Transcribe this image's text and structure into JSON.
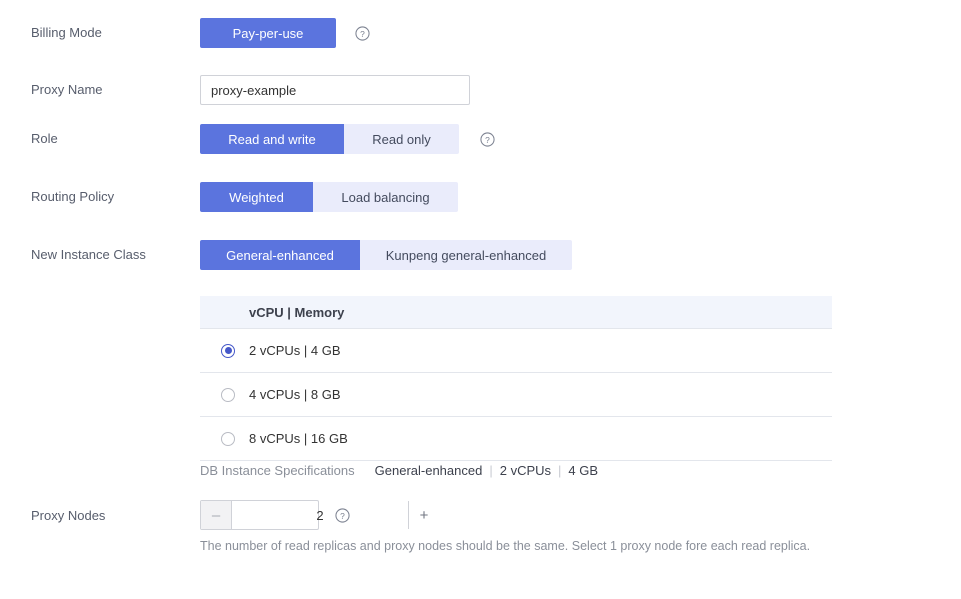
{
  "colors": {
    "accent": "#5b74de",
    "accent_inactive": "#eaecfb",
    "radio_checked": "#4558c9",
    "label": "#575d6c",
    "muted": "#8a8f99",
    "table_header_bg": "#f2f5fc",
    "border": "#e3e6ec"
  },
  "billing_mode": {
    "label": "Billing Mode",
    "options": [
      {
        "label": "Pay-per-use",
        "selected": true
      }
    ],
    "help_icon": "help-circle-icon"
  },
  "proxy_name": {
    "label": "Proxy Name",
    "value": "proxy-example",
    "placeholder": "proxy-example"
  },
  "role": {
    "label": "Role",
    "options": [
      {
        "label": "Read and write",
        "selected": true
      },
      {
        "label": "Read only",
        "selected": false
      }
    ],
    "help_icon": "help-circle-icon"
  },
  "routing_policy": {
    "label": "Routing Policy",
    "options": [
      {
        "label": "Weighted",
        "selected": true
      },
      {
        "label": "Load balancing",
        "selected": false
      }
    ]
  },
  "instance_class": {
    "label": "New Instance Class",
    "options": [
      {
        "label": "General-enhanced",
        "selected": true
      },
      {
        "label": "Kunpeng general-enhanced",
        "selected": false
      }
    ]
  },
  "spec_table": {
    "columns": [
      "vCPU | Memory"
    ],
    "rows": [
      {
        "label": "2 vCPUs | 4 GB",
        "selected": true
      },
      {
        "label": "4 vCPUs | 8 GB",
        "selected": false
      },
      {
        "label": "8 vCPUs | 16 GB",
        "selected": false
      }
    ]
  },
  "spec_summary": {
    "label": "DB Instance Specifications",
    "class": "General-enhanced",
    "vcpus": "2 vCPUs",
    "memory": "4 GB",
    "separator": "|"
  },
  "proxy_nodes": {
    "label": "Proxy Nodes",
    "value": "2",
    "decrement_label": "–",
    "increment_label": "+",
    "help_icon": "help-circle-icon",
    "hint": "The number of read replicas and proxy nodes should be the same. Select 1 proxy node fore each read replica."
  }
}
